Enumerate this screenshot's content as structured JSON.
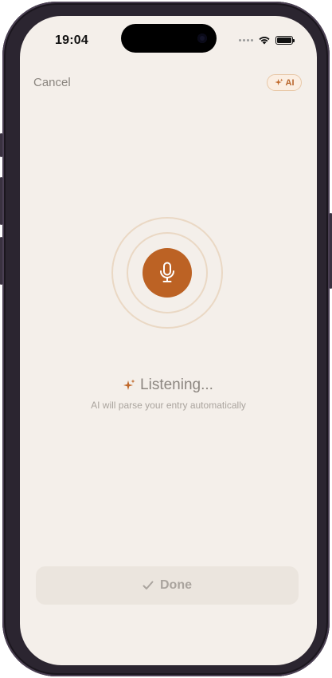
{
  "status_bar": {
    "time": "19:04"
  },
  "header": {
    "cancel_label": "Cancel",
    "ai_badge_label": "AI",
    "ai_icon": "sparkle-icon"
  },
  "voice_input": {
    "mic_icon": "microphone-icon",
    "status_text": "Listening...",
    "subtitle": "AI will parse your entry automatically",
    "accent_color": "#bc6224"
  },
  "footer": {
    "done_label": "Done",
    "done_icon": "checkmark-icon"
  }
}
